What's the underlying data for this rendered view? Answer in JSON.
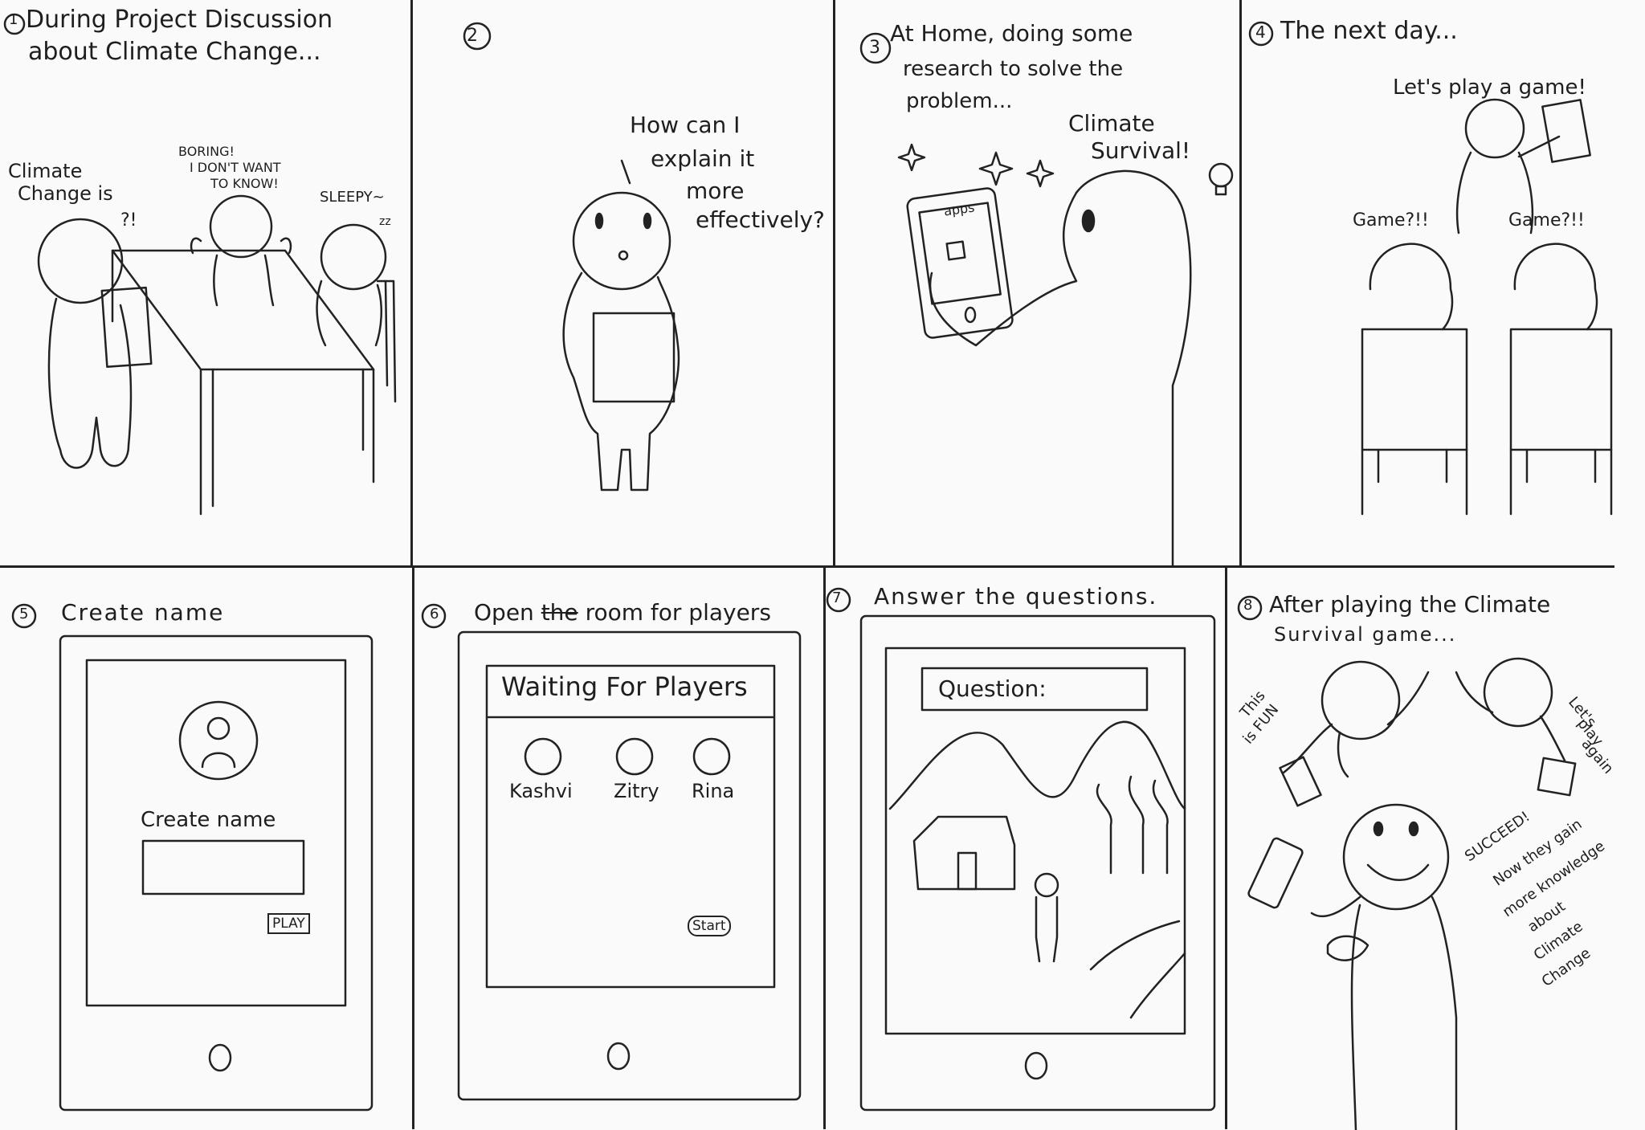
{
  "panels": [
    {
      "num": "1",
      "caption_1": "During Project Discussion",
      "caption_2": "about Climate Change...",
      "speech_left_1": "Climate",
      "speech_left_2": "Change is",
      "speech_left_3": "?!",
      "speech_mid_1": "BORING!",
      "speech_mid_2": "I DON'T WANT",
      "speech_mid_3": "TO KNOW!",
      "speech_right_1": "SLEEPY~",
      "speech_right_2": "zz"
    },
    {
      "num": "2",
      "speech_1": "How can I",
      "speech_2": "explain it",
      "speech_3": "more",
      "speech_4": "effectively?"
    },
    {
      "num": "3",
      "caption_1": "At Home, doing some",
      "caption_2": "research to solve the",
      "caption_3": "problem...",
      "speech_1": "Climate",
      "speech_2": "Survival!",
      "phone_label": "apps"
    },
    {
      "num": "4",
      "caption": "The next day...",
      "speech_top": "Let's play a game!",
      "speech_left": "Game?!!",
      "speech_right": "Game?!!"
    },
    {
      "num": "5",
      "caption": "Create name",
      "field_label": "Create name",
      "button": "PLAY"
    },
    {
      "num": "6",
      "caption_a": "Open",
      "caption_strike": "the",
      "caption_b": "room for players",
      "header": "Waiting For Players",
      "players": [
        "Kashvi",
        "Zitry",
        "Rina"
      ],
      "button": "Start"
    },
    {
      "num": "7",
      "caption": "Answer the questions.",
      "question_label": "Question:"
    },
    {
      "num": "8",
      "caption_1": "After playing the Climate",
      "caption_2": "Survival game...",
      "speech_left_1": "This",
      "speech_left_2": "is FUN",
      "speech_right_1": "Let's",
      "speech_right_2": "play",
      "speech_right_3": "again",
      "note_1": "SUCCEED!",
      "note_2": "Now they gain",
      "note_3": "more knowledge",
      "note_4": "about",
      "note_5": "Climate",
      "note_6": "Change"
    }
  ]
}
